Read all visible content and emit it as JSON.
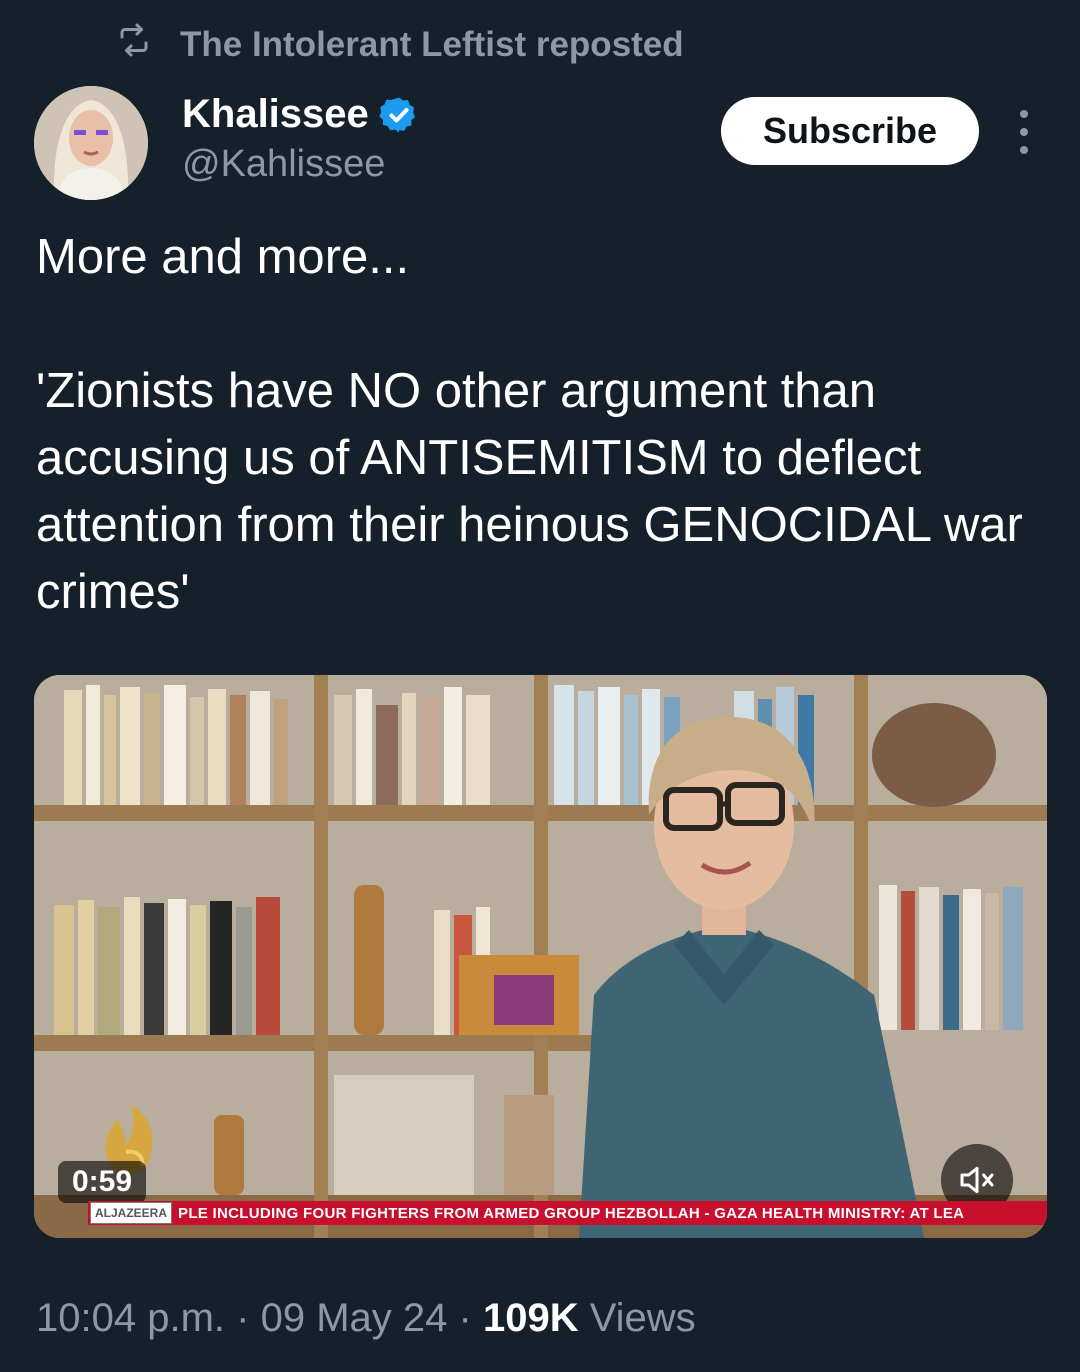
{
  "repost": {
    "icon": "repost-icon",
    "label": "The Intolerant Leftist reposted"
  },
  "author": {
    "display_name": "Khalissee",
    "handle": "@Kahlissee",
    "verified": true,
    "verified_color": "#1d9bf0"
  },
  "actions": {
    "subscribe_label": "Subscribe",
    "more_icon": "more-vertical-icon"
  },
  "tweet": {
    "line1": "More and more...",
    "line2": "'Zionists have NO other argument than accusing us of ANTISEMITISM to deflect attention from their heinous GENOCIDAL war crimes'"
  },
  "video": {
    "duration": "0:59",
    "mute_icon": "volume-muted-icon",
    "ticker_brand": "ALJAZEERA",
    "ticker_text": "PLE INCLUDING FOUR FIGHTERS FROM ARMED GROUP HEZBOLLAH  -  GAZA HEALTH MINISTRY: AT LEA"
  },
  "meta": {
    "time": "10:04 p.m.",
    "sep": "·",
    "date": "09 May 24",
    "views_count": "109K",
    "views_label": "Views"
  },
  "colors": {
    "background": "#15202b",
    "secondary_text": "#8b98a5",
    "ticker_red": "#c8102e"
  }
}
